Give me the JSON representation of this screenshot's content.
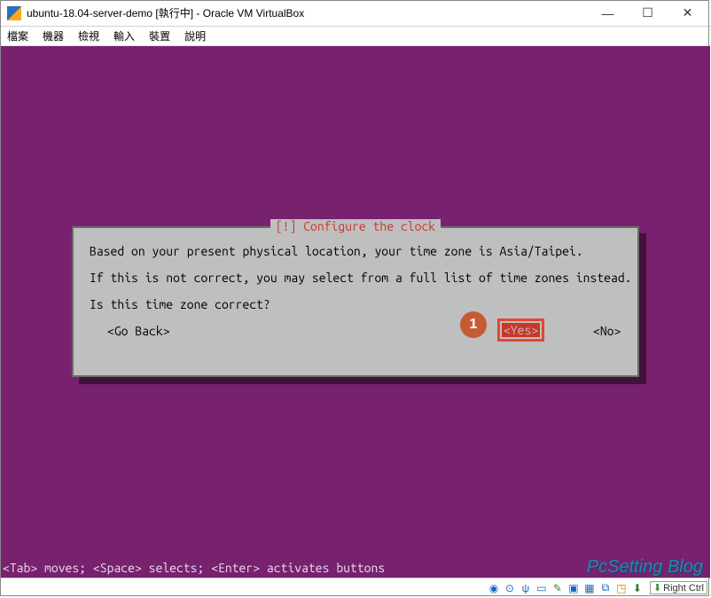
{
  "window": {
    "title": "ubuntu-18.04-server-demo [執行中] - Oracle VM VirtualBox"
  },
  "menu": {
    "file": "檔案",
    "machine": "機器",
    "view": "檢視",
    "input": "輸入",
    "devices": "裝置",
    "help": "說明"
  },
  "dialog": {
    "title": "[!] Configure the clock",
    "line1": "Based on your present physical location, your time zone is Asia/Taipei.",
    "line2": "If this is not correct, you may select from a full list of time zones instead.",
    "line3": "Is this time zone correct?",
    "go_back": "<Go Back>",
    "yes": "<Yes>",
    "no": "<No>"
  },
  "annotation": {
    "step1": "1"
  },
  "help_line": "<Tab> moves; <Space> selects; <Enter> activates buttons",
  "watermark": "PcSetting Blog",
  "status": {
    "hostkey": "Right Ctrl"
  }
}
